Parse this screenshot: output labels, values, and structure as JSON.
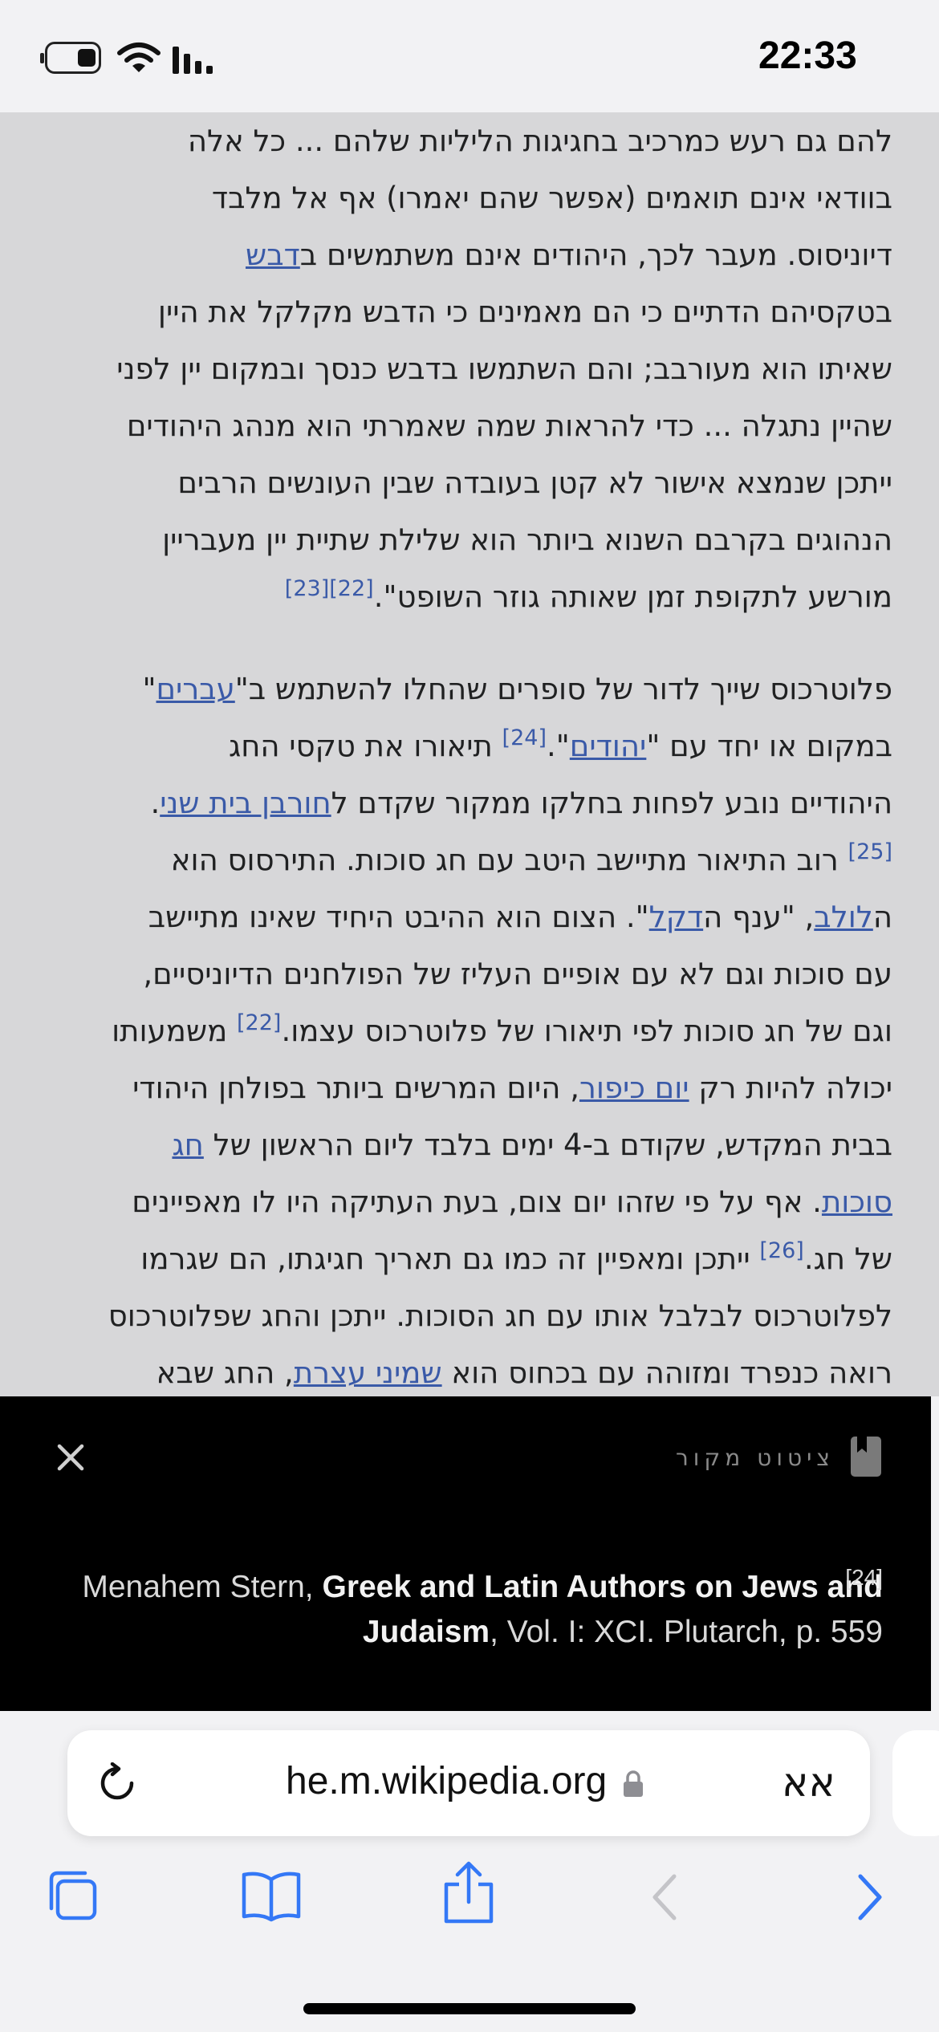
{
  "status_bar": {
    "time": "22:33"
  },
  "article": {
    "paragraphs": [
      {
        "lines": [
          [
            {
              "t": "להם גם רעש כמרכיב בחגיגות הליליות שלהם ... כל אלה"
            }
          ],
          [
            {
              "t": "בוודאי אינם תואמים (אפשר שהם יאמרו) אף אל מלבד"
            }
          ],
          [
            {
              "t": "דיוניסוס. מעבר לכך, היהודים אינם משתמשים ב"
            },
            {
              "t": "דבש",
              "link": true
            }
          ],
          [
            {
              "t": "בטקסיהם הדתיים כי הם מאמינים כי הדבש מקלקל את היין"
            }
          ],
          [
            {
              "t": "שאיתו הוא מעורבב; והם השתמשו בדבש כנסך ובמקום יין לפני"
            }
          ],
          [
            {
              "t": "שהיין נתגלה ... כדי להראות שמה שאמרתי הוא מנהג היהודים"
            }
          ],
          [
            {
              "t": "ייתכן שנמצא אישור לא קטן בעובדה שבין העונשים הרבים"
            }
          ],
          [
            {
              "t": "הנהוגים בקרבם השנוא ביותר הוא שלילת שתיית יין מעבריין"
            }
          ],
          [
            {
              "t": "מורשע לתקופת זמן שאותה גוזר השופט\"."
            },
            {
              "t": "[22]",
              "ref": true
            },
            {
              "t": "[23]",
              "ref": true
            }
          ]
        ]
      },
      {
        "lines": [
          [
            {
              "t": "פלוטרכוס שייך לדור של סופרים שהחלו להשתמש ב\""
            },
            {
              "t": "עברים",
              "link": true
            },
            {
              "t": "\""
            }
          ],
          [
            {
              "t": "במקום או יחד עם \""
            },
            {
              "t": "יהודים",
              "link": true
            },
            {
              "t": "\"."
            },
            {
              "t": "[24]",
              "ref": true
            },
            {
              "t": " תיאורו את טקסי החג"
            }
          ],
          [
            {
              "t": "היהודיים נובע לפחות בחלקו ממקור שקדם ל"
            },
            {
              "t": "חורבן בית שני",
              "link": true
            },
            {
              "t": "."
            }
          ],
          [
            {
              "t": "[25]",
              "ref": true
            },
            {
              "t": " רוב התיאור מתיישב היטב עם חג סוכות. התירסוס הוא"
            }
          ],
          [
            {
              "t": "ה"
            },
            {
              "t": "לולב",
              "link": true
            },
            {
              "t": ", \"ענף ה"
            },
            {
              "t": "דקל",
              "link": true
            },
            {
              "t": "\". הצום הוא ההיבט היחיד שאינו מתיישב"
            }
          ],
          [
            {
              "t": "עם סוכות וגם לא עם אופיים העליז של הפולחנים הדיוניסיים,"
            }
          ],
          [
            {
              "t": "וגם של חג סוכות לפי תיאורו של פלוטרכוס עצמו."
            },
            {
              "t": "[22]",
              "ref": true
            },
            {
              "t": " משמעותו"
            }
          ],
          [
            {
              "t": "יכולה להיות רק "
            },
            {
              "t": "יום כיפור",
              "link": true
            },
            {
              "t": ", היום המרשים ביותר בפולחן היהודי"
            }
          ],
          [
            {
              "t": "בבית המקדש, שקודם ב-4 ימים בלבד ליום הראשון של "
            },
            {
              "t": "חג",
              "link": true
            }
          ],
          [
            {
              "t": "סוכות",
              "link": true
            },
            {
              "t": ". אף על פי שזהו יום צום, בעת העתיקה היו לו מאפיינים"
            }
          ],
          [
            {
              "t": "של חג."
            },
            {
              "t": "[26]",
              "ref": true
            },
            {
              "t": " ייתכן ומאפיין זה כמו גם תאריך חגיגתו, הם שגרמו"
            }
          ],
          [
            {
              "t": "לפלוטרכוס לבלבל אותו עם חג הסוכות. ייתכן והחג שפלוטרכוס"
            }
          ],
          [
            {
              "t": "רואה כנפרד ומזוהה עם בכחוס הוא "
            },
            {
              "t": "שמיני עצרת",
              "link": true
            },
            {
              "t": ", החג שבא"
            }
          ]
        ]
      }
    ]
  },
  "citation_popup": {
    "header": "ציטוט מקור",
    "ref_number": "[24]",
    "author": "Menahem Stern, ",
    "book_title": "Greek and Latin Authors on Jews and Judaism",
    "details": ", Vol. I: XCI. Plutarch, p. 559",
    "close_icon": "close-icon",
    "header_icon": "bookmark-icon"
  },
  "url_bar": {
    "url": "he.m.wikipedia.org",
    "text_size_label": "אא"
  },
  "colors": {
    "link": "#3a5aa8",
    "toolbar_accent": "#3478f6",
    "popup_bg": "#000000",
    "article_bg": "#d7d7d9"
  }
}
